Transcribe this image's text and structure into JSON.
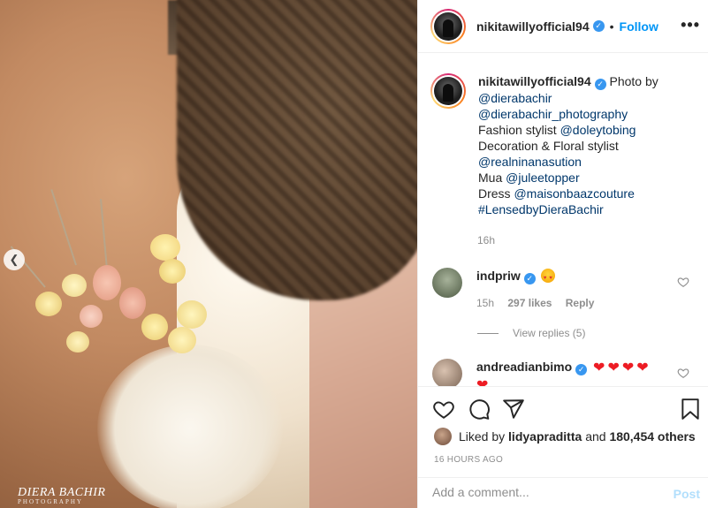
{
  "photo": {
    "credit_main": "DIERA BACHIR",
    "credit_sub": "PHOTOGRAPHY",
    "prev_icon": "chevron-left-icon",
    "colors": {
      "background": "#c28a62"
    }
  },
  "header": {
    "username": "nikitawillyofficial94",
    "separator": "•",
    "follow_label": "Follow",
    "more_icon": "•••"
  },
  "caption": {
    "username": "nikitawillyofficial94",
    "intro": "Photo by",
    "line_1": "@dierabachir",
    "line_2": "@dierabachir_photography",
    "line_3_prefix": "Fashion stylist ",
    "line_3_mention": "@doleytobing",
    "line_4": "Decoration & Floral stylist",
    "line_5": "@realninanasution",
    "line_6_prefix": "Mua ",
    "line_6_mention": "@juleetopper",
    "line_7_prefix": "Dress ",
    "line_7_mention": "@maisonbaazcouture",
    "line_8": "#LensedbyDieraBachir",
    "time": "16h"
  },
  "comments": [
    {
      "username": "indpriw",
      "time": "15h",
      "likes": "297 likes",
      "reply_label": "Reply"
    },
    {
      "username": "andreadianbimo"
    }
  ],
  "view_replies": "View replies (5)",
  "likes": {
    "prefix": "Liked by",
    "user": "lidyapraditta",
    "middle": "and",
    "count": "180,454 others"
  },
  "timestamp": "16 HOURS AGO",
  "comment_box": {
    "placeholder": "Add a comment...",
    "post_label": "Post"
  },
  "colors": {
    "accent": "#0095f6",
    "verified": "#3897f0",
    "mention": "#00376b",
    "muted": "#8e8e8e"
  }
}
